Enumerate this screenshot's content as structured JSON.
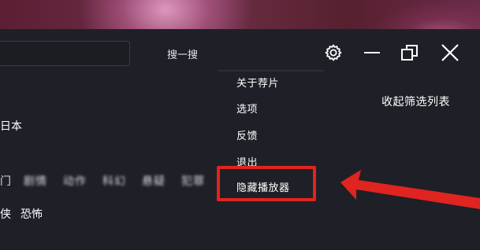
{
  "header": {
    "search_label": "搜一搜",
    "search_value": ""
  },
  "window_controls": {
    "settings_icon": "gear-icon",
    "minimize_icon": "minimize-icon",
    "restore_icon": "restore-icon",
    "close_icon": "close-icon"
  },
  "settings_menu": {
    "items": [
      "关于荐片",
      "选项",
      "反馈",
      "退出",
      "隐藏播放器"
    ]
  },
  "filters": {
    "collapse_label": "收起筛选列表",
    "region_label": "日本",
    "genres_row1": [
      "门",
      "剧情",
      "动作",
      "科幻",
      "悬疑",
      "犯罪"
    ],
    "genres_row2": [
      "侠",
      "恐怖"
    ]
  },
  "annotation": {
    "highlight_color": "#e0241f",
    "arrow_color": "#e0241f"
  }
}
